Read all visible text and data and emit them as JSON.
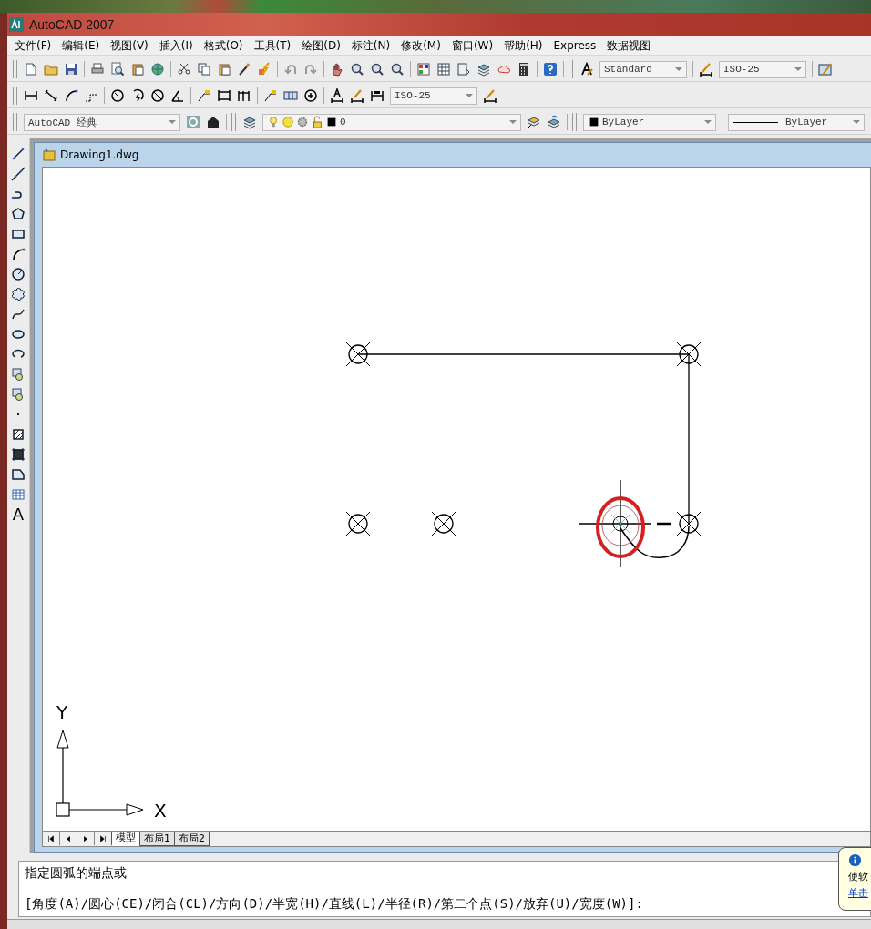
{
  "window": {
    "title": "AutoCAD 2007"
  },
  "menu": [
    "文件(F)",
    "编辑(E)",
    "视图(V)",
    "插入(I)",
    "格式(O)",
    "工具(T)",
    "绘图(D)",
    "标注(N)",
    "修改(M)",
    "窗口(W)",
    "帮助(H)",
    "Express",
    "数据视图"
  ],
  "styles_toolbar": {
    "text_style": "Standard",
    "dim_style": "ISO-25"
  },
  "dimension_toolbar": {
    "dim_style": "ISO-25"
  },
  "workspace": {
    "value": "AutoCAD 经典"
  },
  "layers": {
    "current": "0"
  },
  "properties": {
    "color_setting": "ByLayer",
    "linetype": "ByLayer"
  },
  "draw_toolbar": {
    "text_glyph": "A"
  },
  "drawing": {
    "title": "Drawing1.dwg",
    "ucs_y": "Y",
    "ucs_x": "X"
  },
  "layout_tabs": [
    {
      "label": "模型",
      "selected": true
    },
    {
      "label": "布局1",
      "selected": false
    },
    {
      "label": "布局2",
      "selected": false
    }
  ],
  "command_lines": [
    "指定圆弧的端点或",
    "[角度(A)/圆心(CE)/闭合(CL)/方向(D)/半宽(H)/直线(L)/半径(R)/第二个点(S)/放弃(U)/宽度(W)]:"
  ],
  "notification": {
    "text": "使软",
    "link": "单击"
  }
}
